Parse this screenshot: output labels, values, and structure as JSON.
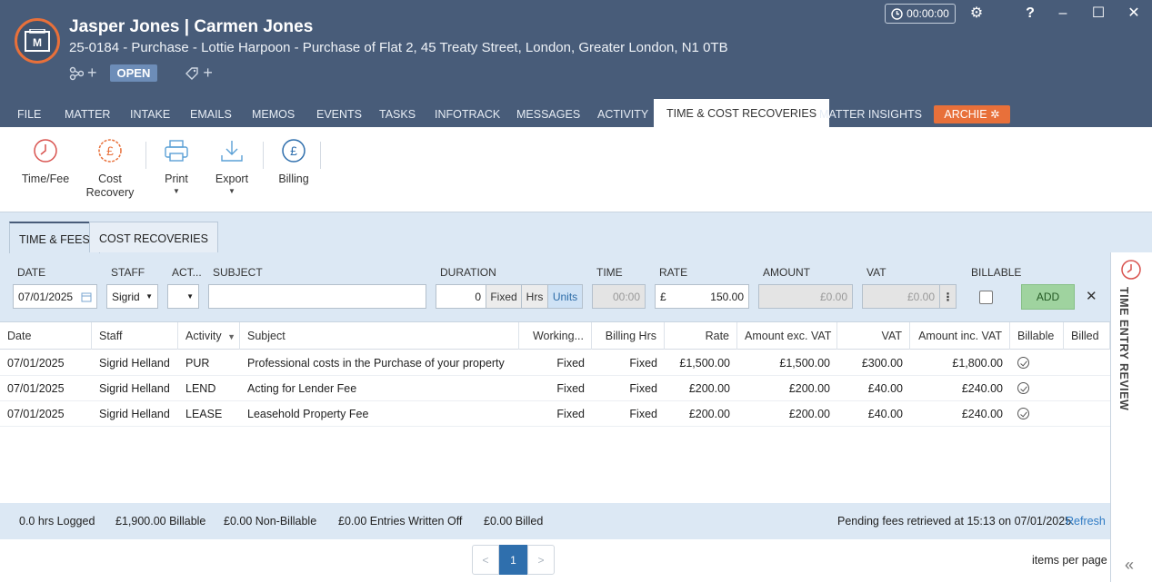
{
  "header": {
    "title": "Jasper Jones | Carmen Jones",
    "subtitle": "25-0184 - Purchase - Lottie Harpoon - Purchase of Flat 2, 45 Treaty Street, London, Greater London, N1 0TB",
    "status_badge": "OPEN",
    "timer": "00:00:00",
    "accent": "#e8703a",
    "background": "#485c79"
  },
  "tabs": [
    "FILE",
    "MATTER",
    "INTAKE",
    "EMAILS",
    "MEMOS",
    "EVENTS",
    "TASKS",
    "INFOTRACK",
    "MESSAGES",
    "ACTIVITY",
    "TIME & COST RECOVERIES",
    "MATTER INSIGHTS"
  ],
  "archie_label": "ARCHIE",
  "toolbar": {
    "time_fee": "Time/Fee",
    "cost_recovery_1": "Cost",
    "cost_recovery_2": "Recovery",
    "print": "Print",
    "export": "Export",
    "billing": "Billing"
  },
  "subtabs": [
    "TIME & FEES",
    "COST RECOVERIES"
  ],
  "side_panel_label": "TIME ENTRY REVIEW",
  "form": {
    "labels": {
      "date": "DATE",
      "staff": "STAFF",
      "activity": "ACT...",
      "subject": "SUBJECT",
      "duration": "DURATION",
      "time": "TIME",
      "rate": "RATE",
      "amount": "AMOUNT",
      "vat": "VAT",
      "billable": "BILLABLE"
    },
    "date_value": "07/01/2025",
    "staff_value": "Sigrid",
    "subject_value": "",
    "duration_value": "0",
    "duration_modes": [
      "Fixed",
      "Hrs",
      "Units"
    ],
    "time_value": "00:00",
    "rate_currency": "£",
    "rate_value": "150.00",
    "amount_value": "£0.00",
    "vat_value": "£0.00",
    "billable": false,
    "add_label": "ADD"
  },
  "grid": {
    "columns": [
      "Date",
      "Staff",
      "Activity",
      "Subject",
      "Working...",
      "Billing Hrs",
      "Rate",
      "Amount exc. VAT",
      "VAT",
      "Amount inc. VAT",
      "Billable",
      "Billed"
    ],
    "rows": [
      {
        "date": "07/01/2025",
        "staff": "Sigrid Helland",
        "activity": "PUR",
        "subject": "Professional costs in the Purchase of your property",
        "working": "Fixed",
        "billing_hrs": "Fixed",
        "rate": "£1,500.00",
        "amount_exc": "£1,500.00",
        "vat": "£300.00",
        "amount_inc": "£1,800.00",
        "billable": true
      },
      {
        "date": "07/01/2025",
        "staff": "Sigrid Helland",
        "activity": "LEND",
        "subject": "Acting for Lender Fee",
        "working": "Fixed",
        "billing_hrs": "Fixed",
        "rate": "£200.00",
        "amount_exc": "£200.00",
        "vat": "£40.00",
        "amount_inc": "£240.00",
        "billable": true
      },
      {
        "date": "07/01/2025",
        "staff": "Sigrid Helland",
        "activity": "LEASE",
        "subject": "Leasehold Property Fee",
        "working": "Fixed",
        "billing_hrs": "Fixed",
        "rate": "£200.00",
        "amount_exc": "£200.00",
        "vat": "£40.00",
        "amount_inc": "£240.00",
        "billable": true
      }
    ]
  },
  "summary": {
    "logged": "0.0 hrs Logged",
    "billable": "£1,900.00 Billable",
    "non_billable": "£0.00 Non-Billable",
    "written_off": "£0.00 Entries Written Off",
    "billed": "£0.00 Billed",
    "pending": "Pending fees retrieved at 15:13 on 07/01/2025.",
    "refresh": "Refresh"
  },
  "pager": {
    "prev": "<",
    "current": "1",
    "next": ">",
    "items_per_page": "items per page"
  }
}
